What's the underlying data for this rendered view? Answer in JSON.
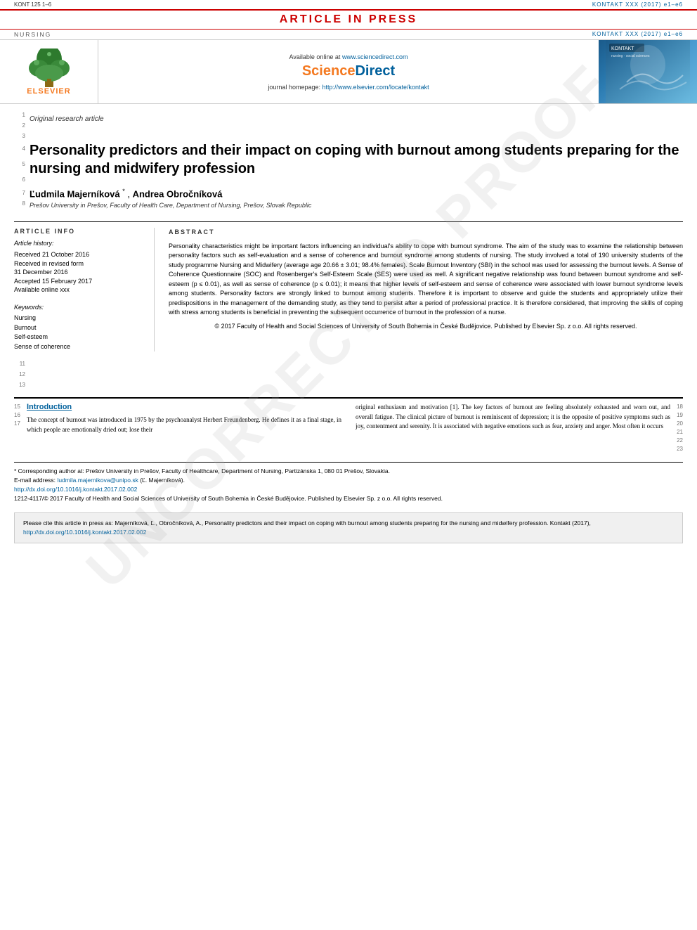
{
  "banner": {
    "article_in_press": "ARTICLE IN PRESS",
    "doc_id": "KONT 125 1–6",
    "journal_label": "NURSING",
    "journal_ref": "KONTAKT XXX (2017) e1–e6"
  },
  "journal_header": {
    "available_online": "Available online at",
    "available_url": "www.sciencedirect.com",
    "sciencedirect_label": "ScienceDirect",
    "homepage_label": "journal homepage:",
    "homepage_url": "http://www.elsevier.com/locate/kontakt",
    "elsevier_label": "ELSEVIER"
  },
  "article": {
    "type": "Original research article",
    "title": "Personality predictors and their impact on coping with burnout among students preparing for the nursing and midwifery profession",
    "authors": "Ľudmila Majerníková *, Andrea Obročníková",
    "author1": "Ľudmila Majerníková",
    "author2": "Andrea Obročníková",
    "affiliation": "Prešov University in Prešov, Faculty of Health Care, Department of Nursing, Prešov, Slovak Republic"
  },
  "article_info": {
    "section_title": "ARTICLE INFO",
    "history_title": "Article history:",
    "received": "Received 21 October 2016",
    "received_revised": "Received in revised form",
    "revised_date": "31 December 2016",
    "accepted": "Accepted 15 February 2017",
    "available": "Available online xxx",
    "keywords_title": "Keywords:",
    "keyword1": "Nursing",
    "keyword2": "Burnout",
    "keyword3": "Self-esteem",
    "keyword4": "Sense of coherence"
  },
  "abstract": {
    "section_title": "ABSTRACT",
    "text": "Personality characteristics might be important factors influencing an individual's ability to cope with burnout syndrome. The aim of the study was to examine the relationship between personality factors such as self-evaluation and a sense of coherence and burnout syndrome among students of nursing. The study involved a total of 190 university students of the study programme Nursing and Midwifery (average age 20.66 ± 3.01; 98.4% females). Scale Burnout Inventory (SBI) in the school was used for assessing the burnout levels. A Sense of Coherence Questionnaire (SOC) and Rosenberger's Self-Esteem Scale (SES) were used as well. A significant negative relationship was found between burnout syndrome and self-esteem (p ≤ 0.01), as well as sense of coherence (p ≤ 0.01); it means that higher levels of self-esteem and sense of coherence were associated with lower burnout syndrome levels among students. Personality factors are strongly linked to burnout among students. Therefore it is important to observe and guide the students and appropriately utilize their predispositions in the management of the demanding study, as they tend to persist after a period of professional practice. It is therefore considered, that improving the skills of coping with stress among students is beneficial in preventing the subsequent occurrence of burnout in the profession of a nurse.",
    "copyright": "© 2017 Faculty of Health and Social Sciences of University of South Bohemia in České Budějovice. Published by Elsevier Sp. z o.o. All rights reserved."
  },
  "line_numbers": {
    "top": [
      "1",
      "2",
      "3",
      "4",
      "5",
      "6",
      "7",
      "8"
    ],
    "intro_left": [
      "15",
      "16",
      "17"
    ],
    "intro_right": [
      "18",
      "19",
      "20",
      "21",
      "22",
      "23"
    ],
    "middle": [
      "11",
      "12",
      "13"
    ]
  },
  "introduction": {
    "title": "Introduction",
    "left_text": "The concept of burnout was introduced in 1975 by the psychoanalyst Herbert Freundenberg. He defines it as a final stage, in which people are emotionally dried out; lose their",
    "right_text": "original enthusiasm and motivation [1]. The key factors of burnout are feeling absolutely exhausted and worn out, and overall fatigue. The clinical picture of burnout is reminiscent of depression; it is the opposite of positive symptoms such as joy, contentment and serenity. It is associated with negative emotions such as fear, anxiety and anger. Most often it occurs"
  },
  "footnotes": {
    "corresponding": "* Corresponding author at: Prešov University in Prešov, Faculty of Healthcare, Department of Nursing, Partizánska 1, 080 01 Prešov, Slovakia.",
    "email_label": "E-mail address:",
    "email": "ludmila.majernikova@unipo.sk",
    "email_name": "(Ľ. Majerníková).",
    "doi": "http://dx.doi.org/10.1016/j.kontakt.2017.02.002",
    "issn": "1212-4117/© 2017 Faculty of Health and Social Sciences of University of South Bohemia in České Budějovice. Published by Elsevier Sp. z o.o. All rights reserved."
  },
  "citation": {
    "text": "Please cite this article in press as: Majerníková, Ľ., Obročníková, A., Personality predictors and their impact on coping with burnout among students preparing for the nursing and midwifery profession. Kontakt (2017),",
    "doi": "http://dx.doi.org/10.1016/j.kontakt.2017.02.002"
  },
  "watermark": {
    "text": "UNCORRECTED PROOF"
  },
  "colors": {
    "accent": "#00609c",
    "elsevier_orange": "#f47920",
    "red": "#c00"
  }
}
